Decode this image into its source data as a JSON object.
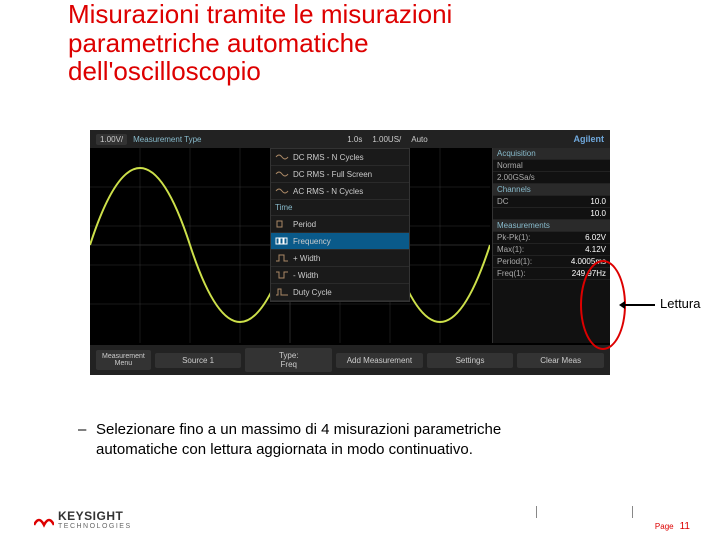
{
  "title_line1": "Misurazioni tramite le misurazioni",
  "title_line2": "parametriche automatiche dell'oscilloscopio",
  "scope": {
    "top_left": "1.00V/",
    "top_mid1": "1.0s",
    "top_mid2": "1.00US/",
    "top_mid3": "Auto",
    "brand": "Agilent",
    "menu_head": "Measurement Type",
    "menu_items": [
      "DC RMS - N Cycles",
      "DC RMS - Full Screen",
      "AC RMS - N Cycles",
      "Time",
      "Period",
      "Frequency",
      "+ Width",
      "- Width",
      "Duty Cycle"
    ],
    "panel": {
      "acq_hd": "Acquisition",
      "acq1": "Normal",
      "acq2": "2.00GSa/s",
      "ch_hd": "Channels",
      "ch_dc": "DC",
      "ch_v1": "10.0",
      "ch_v2": "10.0",
      "meas_hd": "Measurements",
      "m1k": "Pk-Pk(1):",
      "m1v": "6.02V",
      "m2k": "Max(1):",
      "m2v": "4.12V",
      "m3k": "Period(1):",
      "m3v": "4.0005ms",
      "m4k": "Freq(1):",
      "m4v": "249.97Hz"
    },
    "bot_menu": "Measurement Menu",
    "bot_b1": "Source 1",
    "bot_b2a": "Type:",
    "bot_b2b": "Freq",
    "bot_b3": "Add Measurement",
    "bot_b4": "Settings",
    "bot_b5": "Clear Meas"
  },
  "annotation": "Lettura",
  "bullet_text": "Selezionare fino a un massimo di 4 misurazioni parametriche automatiche con lettura aggiornata in modo continuativo.",
  "brand_name": "KEYSIGHT",
  "brand_sub": "TECHNOLOGIES",
  "page_label": "Page",
  "page_num": "11"
}
